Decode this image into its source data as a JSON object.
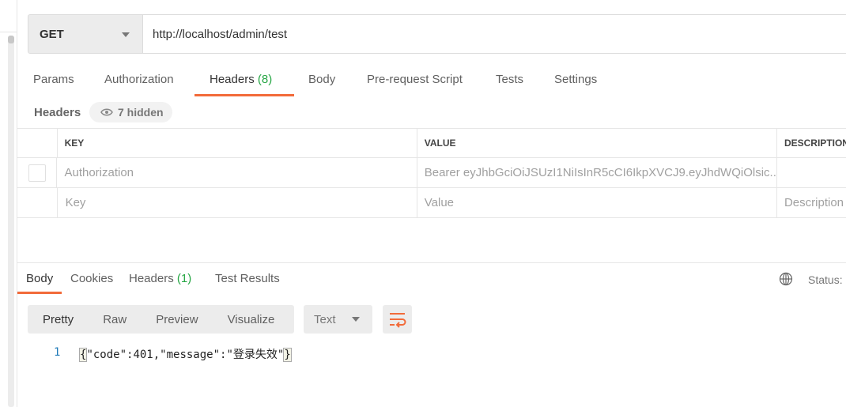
{
  "request": {
    "method": "GET",
    "url": "http://localhost/admin/test"
  },
  "tabs": [
    {
      "label": "Params"
    },
    {
      "label": "Authorization"
    },
    {
      "label": "Headers",
      "count": "(8)"
    },
    {
      "label": "Body"
    },
    {
      "label": "Pre-request Script"
    },
    {
      "label": "Tests"
    },
    {
      "label": "Settings"
    }
  ],
  "active_tab": "Headers",
  "headers_section": {
    "label": "Headers",
    "hidden": "7 hidden"
  },
  "table": {
    "columns": [
      "KEY",
      "VALUE",
      "DESCRIPTION"
    ],
    "rows": [
      {
        "key": "Authorization",
        "value": "Bearer eyJhbGciOiJSUzI1NiIsInR5cCI6IkpXVCJ9.eyJhdWQiOlsic...",
        "description": ""
      }
    ],
    "placeholder": {
      "key": "Key",
      "value": "Value",
      "description": "Description"
    }
  },
  "response": {
    "tabs": [
      {
        "label": "Body"
      },
      {
        "label": "Cookies"
      },
      {
        "label": "Headers",
        "count": "(1)"
      },
      {
        "label": "Test Results"
      }
    ],
    "status_label": "Status:",
    "views": [
      "Pretty",
      "Raw",
      "Preview",
      "Visualize"
    ],
    "format": "Text",
    "lines": [
      {
        "num": "1",
        "open": "{",
        "body": "\"code\":401,\"message\":\"登录失效\"",
        "close": "}"
      }
    ]
  },
  "colors": {
    "accent": "#f26b3a",
    "count": "#26a644"
  }
}
